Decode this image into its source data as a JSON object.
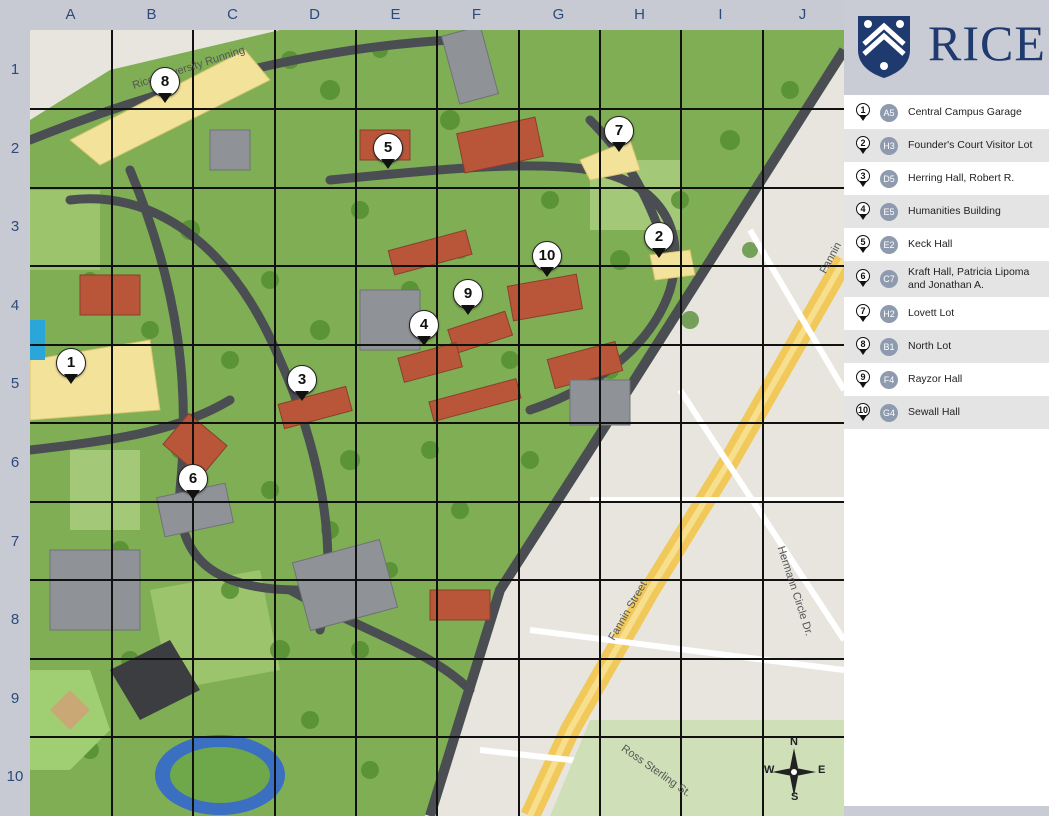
{
  "brand": {
    "name": "RICE",
    "color": "#1e3a6e"
  },
  "grid": {
    "columns": [
      "A",
      "B",
      "C",
      "D",
      "E",
      "F",
      "G",
      "H",
      "I",
      "J"
    ],
    "rows": [
      "1",
      "2",
      "3",
      "4",
      "5",
      "6",
      "7",
      "8",
      "9",
      "10"
    ]
  },
  "markers": [
    {
      "num": "1"
    },
    {
      "num": "2"
    },
    {
      "num": "3"
    },
    {
      "num": "4"
    },
    {
      "num": "5"
    },
    {
      "num": "6"
    },
    {
      "num": "7"
    },
    {
      "num": "8"
    },
    {
      "num": "9"
    },
    {
      "num": "10"
    }
  ],
  "legend": [
    {
      "num": "1",
      "grid": "A5",
      "name": "Central Campus Garage"
    },
    {
      "num": "2",
      "grid": "H3",
      "name": "Founder's Court Visitor Lot"
    },
    {
      "num": "3",
      "grid": "D5",
      "name": "Herring Hall, Robert R."
    },
    {
      "num": "4",
      "grid": "E5",
      "name": "Humanities Building"
    },
    {
      "num": "5",
      "grid": "E2",
      "name": "Keck Hall"
    },
    {
      "num": "6",
      "grid": "C7",
      "name": "Kraft Hall, Patricia Lipoma and Jonathan A."
    },
    {
      "num": "7",
      "grid": "H2",
      "name": "Lovett Lot"
    },
    {
      "num": "8",
      "grid": "B1",
      "name": "North Lot"
    },
    {
      "num": "9",
      "grid": "F4",
      "name": "Rayzor Hall"
    },
    {
      "num": "10",
      "grid": "G4",
      "name": "Sewall Hall"
    }
  ],
  "streets": {
    "running_trail": "Rice University Running",
    "fannin": "Fannin Street",
    "hermann": "Hermann Circle Dr.",
    "ross": "Ross Sterling St.",
    "fannin_edge": "Fannin"
  },
  "compass": {
    "n": "N",
    "e": "E",
    "s": "S",
    "w": "W"
  }
}
